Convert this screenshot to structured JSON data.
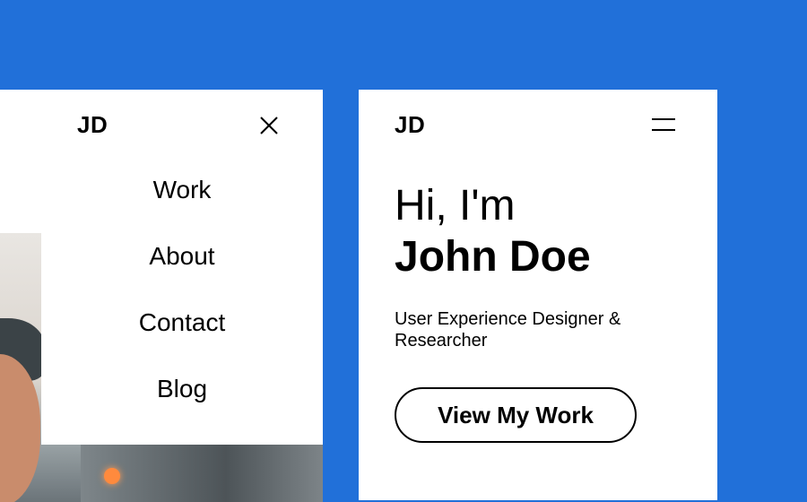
{
  "menu_view": {
    "logo": "JD",
    "close_icon": "close-icon",
    "nav_items": [
      {
        "label": "Work"
      },
      {
        "label": "About"
      },
      {
        "label": "Contact"
      },
      {
        "label": "Blog"
      }
    ]
  },
  "home_view": {
    "logo": "JD",
    "menu_icon": "hamburger-menu-icon",
    "greeting": "Hi, I'm",
    "name": "John Doe",
    "role": "User Experience Designer & Researcher",
    "cta_label": "View My Work"
  },
  "colors": {
    "background": "#2170d9",
    "panel": "#ffffff",
    "text": "#000000"
  }
}
